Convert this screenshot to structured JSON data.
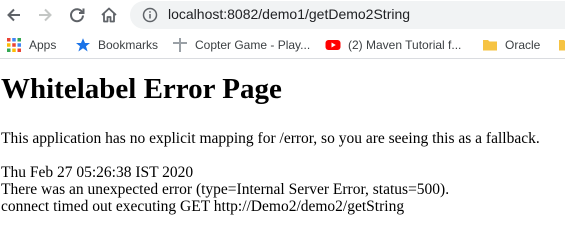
{
  "browser": {
    "url": "localhost:8082/demo1/getDemo2String"
  },
  "bookmarks": [
    {
      "label": "Apps",
      "icon": "apps-grid-icon"
    },
    {
      "label": "Bookmarks",
      "icon": "star-icon"
    },
    {
      "label": "Copter Game - Play...",
      "icon": "page-icon"
    },
    {
      "label": "(2) Maven Tutorial f...",
      "icon": "youtube-icon"
    },
    {
      "label": "Oracle",
      "icon": "folder-icon"
    },
    {
      "label": "",
      "icon": "folder-icon"
    }
  ],
  "page": {
    "heading": "Whitelabel Error Page",
    "explanation": "This application has no explicit mapping for /error, so you are seeing this as a fallback.",
    "timestamp": "Thu Feb 27 05:26:38 IST 2020",
    "error_line": "There was an unexpected error (type=Internal Server Error, status=500).",
    "message": "connect timed out executing GET http://Demo2/demo2/getString"
  },
  "colors": {
    "omnibox_bg": "#f1f3f4",
    "youtube_red": "#ff0000",
    "folder_yellow": "#f6c342",
    "star_blue": "#1a73e8"
  }
}
